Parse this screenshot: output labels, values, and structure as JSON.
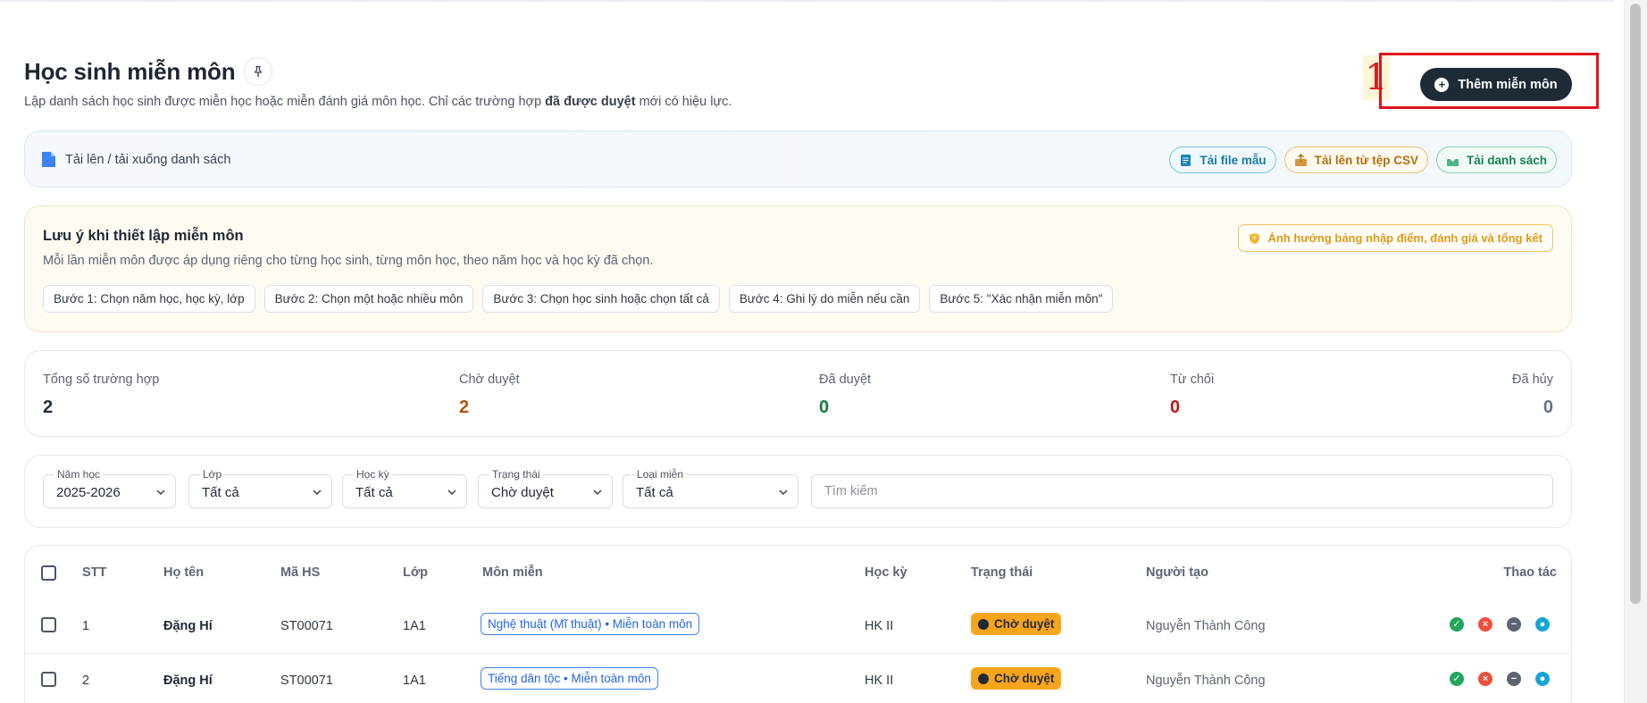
{
  "page": {
    "title": "Học sinh miễn môn",
    "subtitle_pre": "Lập danh sách học sinh được miễn học hoặc miễn đánh giá môn học. Chỉ các trường hợp ",
    "subtitle_bold": "đã được duyệt",
    "subtitle_post": " mới có hiệu lực.",
    "marker": "1",
    "add_button": "Thêm miễn môn"
  },
  "upload": {
    "label": "Tải lên / tải xuống danh sách",
    "buttons": [
      "Tải file mẫu",
      "Tải lên từ tệp CSV",
      "Tải danh sách"
    ]
  },
  "note": {
    "title": "Lưu ý khi thiết lập miễn môn",
    "text": "Mỗi lần miễn môn được áp dụng riêng cho từng học sinh, từng môn học, theo năm học và học kỳ đã chọn.",
    "warning": "Ảnh hưởng bảng nhập điểm, đánh giá và tổng kết",
    "steps": [
      "Bước 1: Chọn năm học, học kỳ, lớp",
      "Bước 2: Chọn một hoặc nhiều môn",
      "Bước 3: Chọn học sinh hoặc chọn tất cả",
      "Bước 4: Ghi lý do miễn nếu cần",
      "Bước 5: \"Xác nhận miễn môn\""
    ]
  },
  "stats": [
    {
      "label": "Tổng số trường hợp",
      "value": "2",
      "color": "#1f2a37"
    },
    {
      "label": "Chờ duyệt",
      "value": "2",
      "color": "#b45309"
    },
    {
      "label": "Đã duyệt",
      "value": "0",
      "color": "#15803d"
    },
    {
      "label": "Từ chối",
      "value": "0",
      "color": "#b91c1c"
    },
    {
      "label": "Đã hủy",
      "value": "0",
      "color": "#64748b"
    }
  ],
  "filters": {
    "year": {
      "label": "Năm học",
      "value": "2025-2026"
    },
    "class": {
      "label": "Lớp",
      "value": "Tất cả"
    },
    "semester": {
      "label": "Học kỳ",
      "value": "Tất cả"
    },
    "status": {
      "label": "Trạng thái",
      "value": "Chờ duyệt"
    },
    "type": {
      "label": "Loại miễn",
      "value": "Tất cả"
    },
    "search_placeholder": "Tìm kiếm"
  },
  "table": {
    "headers": [
      "STT",
      "Họ tên",
      "Mã HS",
      "Lớp",
      "Môn miễn",
      "Học kỳ",
      "Trạng thái",
      "Người tạo",
      "Thao tác"
    ],
    "rows": [
      {
        "stt": "1",
        "name": "Đặng Hí",
        "code": "ST00071",
        "class": "1A1",
        "subject": "Nghệ thuật (Mĩ thuật) • Miễn toàn môn",
        "semester": "HK II",
        "status": "Chờ duyệt",
        "creator": "Nguyễn Thành Công"
      },
      {
        "stt": "2",
        "name": "Đặng Hí",
        "code": "ST00071",
        "class": "1A1",
        "subject": "Tiếng dân tộc • Miễn toàn môn",
        "semester": "HK II",
        "status": "Chờ duyệt",
        "creator": "Nguyễn Thành Công"
      }
    ]
  }
}
